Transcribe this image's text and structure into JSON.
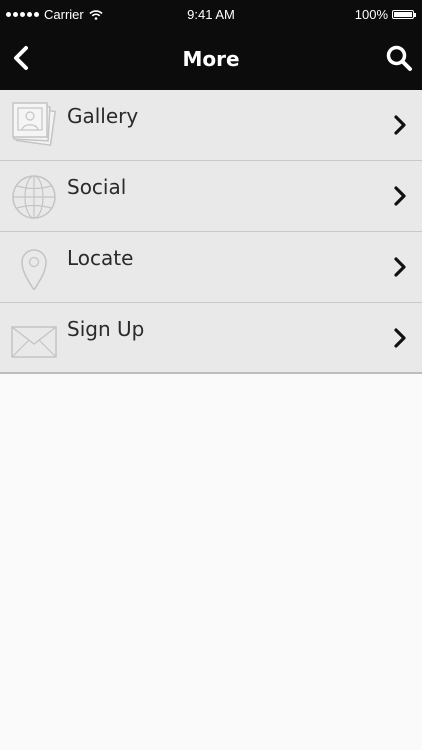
{
  "status_bar": {
    "carrier": "Carrier",
    "time": "9:41 AM",
    "battery": "100%"
  },
  "nav": {
    "title": "More"
  },
  "menu": {
    "items": [
      {
        "label": "Gallery",
        "icon": "gallery-icon"
      },
      {
        "label": "Social",
        "icon": "globe-icon"
      },
      {
        "label": "Locate",
        "icon": "location-pin-icon"
      },
      {
        "label": "Sign Up",
        "icon": "envelope-icon"
      }
    ]
  },
  "colors": {
    "bar_background": "#0c0c0c",
    "row_background": "#e9e9e9",
    "page_background": "#fafafa"
  }
}
